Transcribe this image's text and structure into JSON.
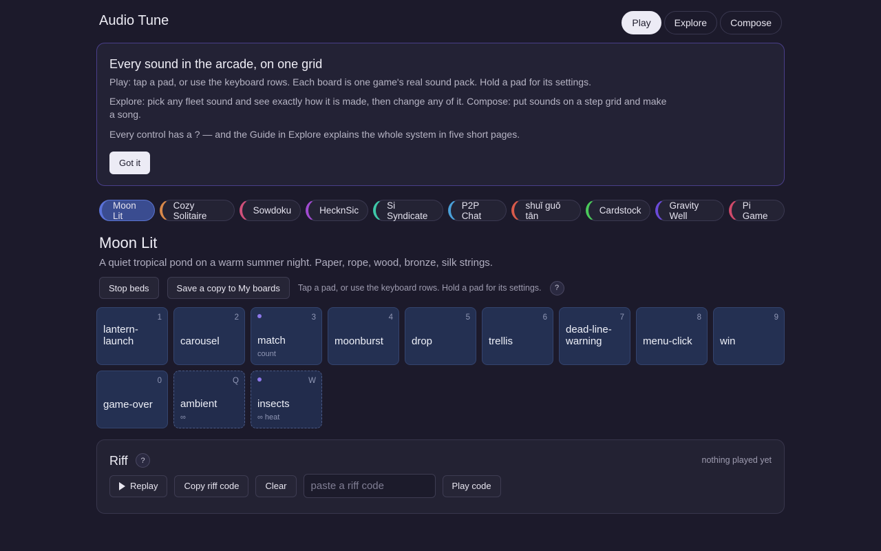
{
  "app": {
    "title": "Audio Tune"
  },
  "modes": [
    {
      "label": "Play",
      "active": true
    },
    {
      "label": "Explore",
      "active": false
    },
    {
      "label": "Compose",
      "active": false
    }
  ],
  "intro": {
    "title": "Every sound in the arcade, on one grid",
    "p1": "Play: tap a pad, or use the keyboard rows. Each board is one game's real sound pack. Hold a pad for its settings.",
    "p2": "Explore: pick any fleet sound and see exactly how it is made, then change any of it. Compose: put sounds on a step grid and make a song.",
    "p3": "Every control has a ? — and the Guide in Explore explains the whole system in five short pages.",
    "dismiss_label": "Got it"
  },
  "boards": [
    {
      "label": "Moon Lit",
      "color": "#5a72d8",
      "active": true
    },
    {
      "label": "Cozy Solitaire",
      "color": "#d8884a"
    },
    {
      "label": "Sowdoku",
      "color": "#d0507a"
    },
    {
      "label": "HecknSic",
      "color": "#a04ad0"
    },
    {
      "label": "Si Syndicate",
      "color": "#3ec8a8"
    },
    {
      "label": "P2P Chat",
      "color": "#4aa0d8"
    },
    {
      "label": "shuǐ guǒ tān",
      "color": "#d85a4a"
    },
    {
      "label": "Cardstock",
      "color": "#4ac85a"
    },
    {
      "label": "Gravity Well",
      "color": "#6a4ad8"
    },
    {
      "label": "Pi Game",
      "color": "#d04a6a"
    }
  ],
  "board": {
    "title": "Moon Lit",
    "description": "A quiet tropical pond on a warm summer night. Paper, rope, wood, bronze, silk strings.",
    "stop_label": "Stop beds",
    "save_label": "Save a copy to My boards",
    "hint": "Tap a pad, or use the keyboard rows. Hold a pad for its settings.",
    "help": "?"
  },
  "pads": [
    {
      "key": "1",
      "name": "lantern-launch",
      "lines": [
        "lantern-",
        "launch"
      ]
    },
    {
      "key": "2",
      "name": "carousel"
    },
    {
      "key": "3",
      "name": "match",
      "tag": "count",
      "dot": true
    },
    {
      "key": "4",
      "name": "moonburst"
    },
    {
      "key": "5",
      "name": "drop"
    },
    {
      "key": "6",
      "name": "trellis"
    },
    {
      "key": "7",
      "name": "dead-line-warning",
      "lines": [
        "dead-line-",
        "warning"
      ]
    },
    {
      "key": "8",
      "name": "menu-click"
    },
    {
      "key": "9",
      "name": "win"
    },
    {
      "key": "0",
      "name": "game-over"
    },
    {
      "key": "Q",
      "name": "ambient",
      "tag": "∞",
      "bed": true
    },
    {
      "key": "W",
      "name": "insects",
      "tag": "∞ heat",
      "bed": true,
      "dot": true
    }
  ],
  "riff": {
    "title": "Riff",
    "help": "?",
    "status": "nothing played yet",
    "replay_label": "Replay",
    "copy_label": "Copy riff code",
    "clear_label": "Clear",
    "code_placeholder": "paste a riff code",
    "play_code_label": "Play code"
  },
  "colors": {
    "accent": "#8d78ea",
    "pad": "#243052",
    "background": "#1c1a2b"
  }
}
